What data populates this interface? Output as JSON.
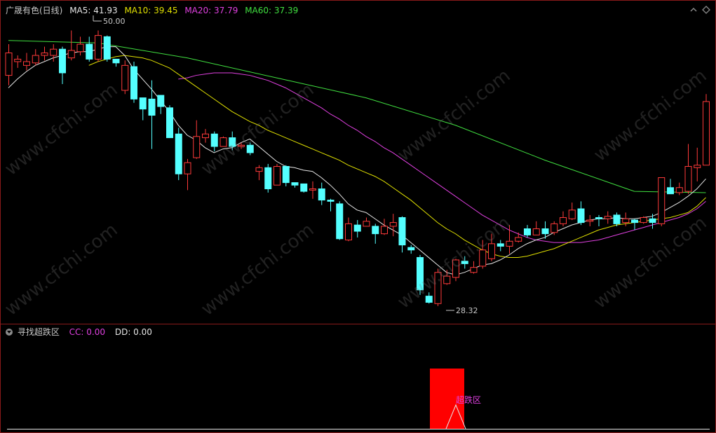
{
  "header": {
    "title": "广晟有色(日线)",
    "ma5": "MA5: 41.93",
    "ma10": "MA10: 39.45",
    "ma20": "MA20: 37.79",
    "ma60": "MA60: 37.39"
  },
  "indicator": {
    "name": "寻找超跌区",
    "cc": "CC: 0.00",
    "dd": "DD: 0.00",
    "zone_label": "超跌区"
  },
  "watermark": "www.cfchi.com",
  "colors": {
    "up": "#ff3a3a",
    "down": "#54ffff",
    "ma5": "#e6e6e6",
    "ma10": "#e0e000",
    "ma20": "#e040e0",
    "ma60": "#40e040",
    "frame": "#8b1a1a",
    "zone": "#ff0000"
  },
  "chart_data": {
    "type": "candlestick",
    "y_range": [
      27.0,
      52.0
    ],
    "high_marker": "50.00",
    "low_marker": "28.32",
    "candles": [
      [
        46.8,
        48.6,
        49.3,
        46.0
      ],
      [
        47.9,
        48.1,
        48.4,
        47.4
      ],
      [
        47.6,
        47.9,
        48.6,
        47.2
      ],
      [
        47.8,
        48.4,
        48.9,
        47.6
      ],
      [
        48.4,
        48.6,
        49.1,
        48.0
      ],
      [
        48.4,
        48.9,
        49.3,
        47.9
      ],
      [
        48.9,
        47.0,
        49.1,
        46.1
      ],
      [
        48.2,
        48.8,
        50.4,
        48.0
      ],
      [
        48.7,
        49.3,
        49.9,
        48.4
      ],
      [
        49.3,
        48.1,
        49.9,
        47.9
      ],
      [
        48.1,
        50.0,
        50.4,
        47.9
      ],
      [
        49.9,
        48.1,
        50.0,
        47.9
      ],
      [
        48.1,
        47.8,
        48.1,
        47.5
      ],
      [
        45.6,
        47.6,
        48.0,
        45.3
      ],
      [
        47.5,
        44.9,
        47.9,
        44.6
      ],
      [
        45.0,
        44.1,
        45.0,
        43.2
      ],
      [
        44.9,
        43.6,
        46.4,
        40.9
      ],
      [
        45.2,
        44.3,
        45.2,
        43.7
      ],
      [
        44.2,
        41.8,
        44.4,
        41.8
      ],
      [
        42.1,
        38.9,
        42.6,
        38.4
      ],
      [
        38.9,
        39.8,
        40.1,
        37.6
      ],
      [
        40.2,
        41.9,
        43.2,
        40.1
      ],
      [
        41.8,
        42.1,
        42.5,
        41.4
      ],
      [
        42.1,
        41.1,
        42.3,
        40.7
      ],
      [
        41.1,
        41.8,
        41.9,
        41.2
      ],
      [
        41.8,
        41.1,
        42.3,
        40.8
      ],
      [
        41.1,
        41.2,
        41.4,
        40.9
      ],
      [
        41.2,
        40.6,
        41.4,
        40.4
      ],
      [
        39.1,
        39.4,
        39.6,
        38.4
      ],
      [
        39.4,
        37.7,
        39.7,
        37.4
      ],
      [
        38.0,
        39.5,
        39.7,
        38.0
      ],
      [
        39.5,
        38.2,
        39.6,
        37.9
      ],
      [
        38.2,
        38.0,
        38.2,
        37.8
      ],
      [
        38.1,
        37.5,
        38.1,
        37.4
      ],
      [
        37.6,
        37.7,
        38.3,
        36.9
      ],
      [
        37.7,
        36.8,
        38.2,
        36.4
      ],
      [
        36.8,
        36.7,
        36.9,
        35.9
      ],
      [
        36.5,
        33.7,
        36.7,
        33.6
      ],
      [
        33.6,
        34.9,
        35.4,
        33.5
      ],
      [
        34.8,
        34.3,
        35.2,
        33.8
      ],
      [
        34.7,
        35.1,
        35.4,
        34.7
      ],
      [
        34.7,
        34.1,
        34.9,
        33.3
      ],
      [
        34.1,
        34.7,
        35.3,
        34.0
      ],
      [
        34.7,
        35.0,
        35.7,
        33.9
      ],
      [
        35.4,
        33.2,
        35.5,
        32.6
      ],
      [
        33.0,
        32.8,
        33.2,
        32.5
      ],
      [
        32.2,
        29.6,
        32.4,
        29.2
      ],
      [
        29.1,
        28.6,
        29.4,
        28.5
      ],
      [
        28.5,
        31.0,
        31.3,
        28.3
      ],
      [
        30.1,
        30.7,
        31.2,
        30.0
      ],
      [
        30.6,
        32.0,
        32.1,
        30.3
      ],
      [
        31.9,
        31.7,
        32.3,
        31.3
      ],
      [
        31.0,
        31.4,
        31.9,
        30.9
      ],
      [
        31.5,
        32.8,
        33.6,
        31.3
      ],
      [
        32.1,
        33.3,
        34.1,
        31.9
      ],
      [
        33.3,
        33.1,
        33.6,
        32.7
      ],
      [
        33.1,
        33.5,
        34.8,
        32.5
      ],
      [
        33.5,
        33.8,
        34.2,
        33.4
      ],
      [
        34.5,
        34.0,
        34.8,
        33.8
      ],
      [
        34.0,
        34.5,
        35.1,
        34.0
      ],
      [
        34.5,
        34.1,
        35.1,
        33.7
      ],
      [
        34.2,
        34.9,
        35.1,
        34.0
      ],
      [
        34.9,
        35.4,
        35.9,
        34.7
      ],
      [
        35.3,
        36.0,
        36.6,
        35.2
      ],
      [
        36.1,
        35.0,
        36.7,
        34.8
      ],
      [
        35.1,
        35.2,
        35.6,
        34.7
      ],
      [
        35.4,
        35.3,
        35.6,
        34.7
      ],
      [
        35.3,
        35.5,
        35.9,
        34.9
      ],
      [
        35.6,
        34.9,
        35.8,
        34.7
      ],
      [
        35.0,
        35.3,
        35.8,
        34.7
      ],
      [
        35.2,
        35.0,
        35.3,
        34.4
      ],
      [
        35.0,
        35.4,
        35.5,
        34.9
      ],
      [
        35.3,
        35.0,
        35.7,
        34.5
      ],
      [
        34.9,
        38.6,
        38.6,
        34.7
      ],
      [
        37.8,
        37.3,
        38.5,
        37.3
      ],
      [
        37.4,
        37.8,
        38.2,
        37.2
      ],
      [
        37.5,
        39.5,
        41.3,
        37.3
      ],
      [
        39.4,
        39.6,
        41.0,
        38.3
      ],
      [
        39.6,
        44.7,
        45.3,
        39.6
      ]
    ],
    "ma5": [
      45.8,
      46.5,
      47.1,
      47.6,
      47.9,
      48.2,
      48.4,
      48.6,
      48.7,
      48.7,
      48.9,
      49.1,
      49.1,
      48.4,
      47.3,
      46.5,
      45.7,
      44.8,
      43.9,
      42.8,
      42.0,
      41.6,
      41.0,
      40.6,
      40.9,
      41.0,
      41.4,
      41.7,
      41.1,
      40.5,
      39.9,
      39.5,
      39.4,
      39.2,
      39.1,
      38.6,
      38.0,
      37.3,
      36.5,
      36.0,
      35.8,
      35.3,
      34.8,
      34.4,
      34.0,
      33.4,
      32.8,
      32.2,
      31.6,
      31.0,
      30.8,
      31.0,
      31.3,
      31.6,
      31.7,
      32.0,
      32.4,
      32.9,
      33.3,
      33.6,
      33.8,
      34.2,
      34.5,
      34.8,
      35.0,
      35.2,
      35.3,
      35.3,
      35.4,
      35.3,
      35.3,
      35.4,
      35.5,
      35.8,
      36.2,
      36.6,
      37.1,
      37.7,
      38.5
    ],
    "ma10": [
      null,
      null,
      null,
      null,
      null,
      null,
      null,
      null,
      null,
      47.6,
      47.9,
      48.1,
      48.3,
      48.4,
      48.3,
      48.2,
      48.0,
      47.7,
      47.4,
      46.9,
      46.4,
      45.9,
      45.4,
      44.9,
      44.4,
      43.9,
      43.5,
      43.1,
      42.8,
      42.4,
      42.1,
      41.8,
      41.5,
      41.2,
      40.9,
      40.6,
      40.3,
      40.0,
      39.6,
      39.3,
      39.0,
      38.7,
      38.3,
      37.8,
      37.3,
      36.8,
      36.2,
      35.6,
      35.0,
      34.5,
      34.1,
      33.6,
      33.2,
      32.8,
      32.5,
      32.3,
      32.2,
      32.2,
      32.3,
      32.5,
      32.7,
      32.9,
      33.2,
      33.5,
      33.8,
      34.1,
      34.4,
      34.6,
      34.8,
      34.9,
      35.0,
      35.1,
      35.2,
      35.3,
      35.4,
      35.6,
      35.8,
      36.3,
      37.0
    ],
    "ma20": [
      null,
      null,
      null,
      null,
      null,
      null,
      null,
      null,
      null,
      null,
      null,
      null,
      null,
      null,
      null,
      null,
      null,
      null,
      null,
      46.5,
      46.6,
      46.8,
      46.9,
      47.0,
      47.0,
      47.0,
      46.9,
      46.8,
      46.6,
      46.4,
      46.1,
      45.8,
      45.4,
      45.0,
      44.6,
      44.2,
      43.7,
      43.3,
      42.8,
      42.4,
      41.9,
      41.5,
      41.0,
      40.6,
      40.1,
      39.6,
      39.1,
      38.6,
      38.1,
      37.6,
      37.1,
      36.6,
      36.1,
      35.6,
      35.2,
      34.8,
      34.4,
      34.1,
      33.8,
      33.6,
      33.5,
      33.4,
      33.4,
      33.4,
      33.4,
      33.5,
      33.6,
      33.8,
      34.0,
      34.2,
      34.4,
      34.6,
      34.8,
      35.0,
      35.2,
      35.4,
      35.7,
      36.1,
      36.7
    ],
    "ma60_line": [
      [
        0,
        49.6
      ],
      [
        10,
        49.4
      ],
      [
        20,
        48.2
      ],
      [
        30,
        46.6
      ],
      [
        40,
        45.0
      ],
      [
        50,
        42.8
      ],
      [
        60,
        40.0
      ],
      [
        70,
        37.5
      ],
      [
        78,
        37.39
      ]
    ]
  }
}
